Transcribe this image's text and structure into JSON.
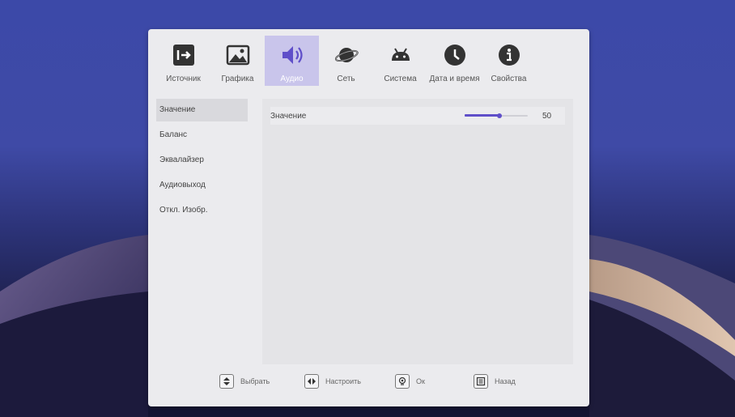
{
  "tabs": [
    {
      "label": "Источник",
      "icon": "source-input-icon",
      "active": false
    },
    {
      "label": "Графика",
      "icon": "picture-icon",
      "active": false
    },
    {
      "label": "Аудио",
      "icon": "speaker-icon",
      "active": true
    },
    {
      "label": "Сеть",
      "icon": "planet-network-icon",
      "active": false
    },
    {
      "label": "Система",
      "icon": "android-icon",
      "active": false
    },
    {
      "label": "Дата и время",
      "icon": "clock-icon",
      "active": false
    },
    {
      "label": "Свойства",
      "icon": "info-icon",
      "active": false
    }
  ],
  "sidebar": {
    "items": [
      {
        "label": "Значение",
        "active": true
      },
      {
        "label": "Баланс",
        "active": false
      },
      {
        "label": "Эквалайзер",
        "active": false
      },
      {
        "label": "Аудиовыход",
        "active": false
      },
      {
        "label": "Откл. Изобр.",
        "active": false
      }
    ]
  },
  "content": {
    "volume": {
      "label": "Значение",
      "value": "50",
      "fraction": 0.55
    }
  },
  "footer": {
    "select": {
      "label": "Выбрать",
      "icon": "up-down-arrows-icon"
    },
    "adjust": {
      "label": "Настроить",
      "icon": "left-right-arrows-icon"
    },
    "ok": {
      "label": "Ок",
      "icon": "ok-button-icon"
    },
    "back": {
      "label": "Назад",
      "icon": "back-menu-icon"
    }
  },
  "colors": {
    "accent": "#5f4fc9",
    "active_tab": "#c9c5eb",
    "panel": "#ebebee"
  }
}
